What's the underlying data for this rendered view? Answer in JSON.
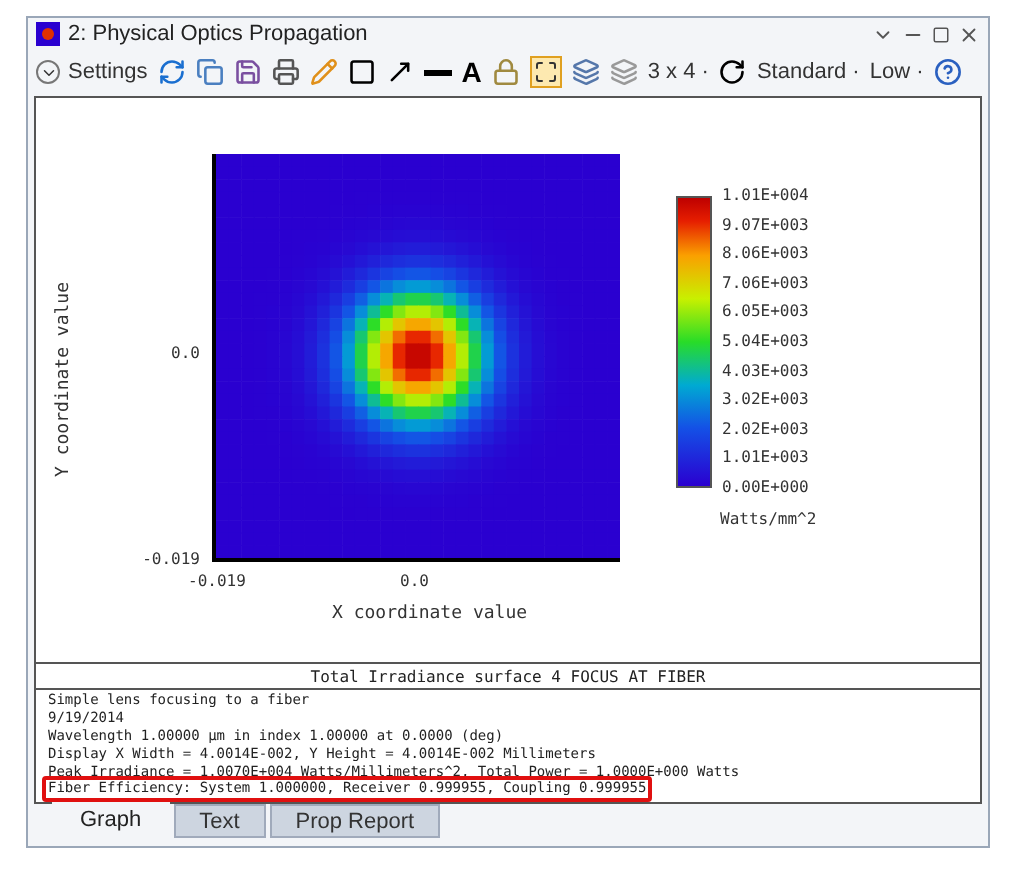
{
  "window": {
    "title": "2: Physical Optics Propagation"
  },
  "toolbar": {
    "settings": "Settings",
    "text_tool": "A",
    "layout": "3 x 4 ·",
    "standard": "Standard ·",
    "sampling": "Low ·"
  },
  "plot": {
    "ylabel": "Y coordinate value",
    "xlabel": "X coordinate value",
    "yticks": [
      "0.0",
      "-0.019"
    ],
    "xticks": [
      "-0.019",
      "0.0"
    ],
    "legend": [
      "1.01E+004",
      "9.07E+003",
      "8.06E+003",
      "7.06E+003",
      "6.05E+003",
      "5.04E+003",
      "4.03E+003",
      "3.02E+003",
      "2.02E+003",
      "1.01E+003",
      "0.00E+000"
    ],
    "unit": "Watts/mm^2"
  },
  "report": {
    "title": "Total Irradiance surface 4 FOCUS AT FIBER",
    "lines": [
      "Simple lens focusing to a fiber",
      "9/19/2014",
      "Wavelength 1.00000 µm in index 1.00000 at 0.0000 (deg)",
      "Display X Width = 4.0014E-002, Y Height = 4.0014E-002 Millimeters",
      "Peak Irradiance = 1.0070E+004 Watts/Millimeters^2, Total Power = 1.0000E+000 Watts"
    ],
    "highlight": "Fiber Efficiency: System 1.000000, Receiver 0.999955, Coupling 0.999955"
  },
  "tabs": [
    {
      "label": "Graph",
      "selected": true
    },
    {
      "label": "Text",
      "selected": false
    },
    {
      "label": "Prop Report",
      "selected": false
    }
  ]
}
